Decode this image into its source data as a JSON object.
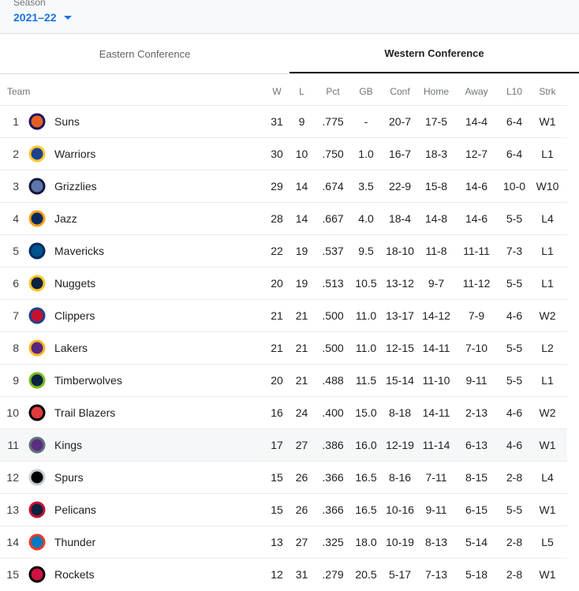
{
  "season": {
    "label": "Season",
    "value": "2021–22"
  },
  "tabs": [
    {
      "label": "Eastern Conference",
      "active": false
    },
    {
      "label": "Western Conference",
      "active": true
    }
  ],
  "columns": [
    "Team",
    "W",
    "L",
    "Pct",
    "GB",
    "Conf",
    "Home",
    "Away",
    "L10",
    "Strk"
  ],
  "teams": [
    {
      "rank": "1",
      "name": "Suns",
      "w": "31",
      "l": "9",
      "pct": ".775",
      "gb": "-",
      "conf": "20-7",
      "home": "17-5",
      "away": "14-4",
      "l10": "6-4",
      "strk": "W1",
      "logo": "suns-logo-icon",
      "color": "#e56020",
      "color2": "#1d1160"
    },
    {
      "rank": "2",
      "name": "Warriors",
      "w": "30",
      "l": "10",
      "pct": ".750",
      "gb": "1.0",
      "conf": "16-7",
      "home": "18-3",
      "away": "12-7",
      "l10": "6-4",
      "strk": "L1",
      "logo": "warriors-logo-icon",
      "color": "#1d428a",
      "color2": "#ffc72c"
    },
    {
      "rank": "3",
      "name": "Grizzlies",
      "w": "29",
      "l": "14",
      "pct": ".674",
      "gb": "3.5",
      "conf": "22-9",
      "home": "15-8",
      "away": "14-6",
      "l10": "10-0",
      "strk": "W10",
      "logo": "grizzlies-logo-icon",
      "color": "#5d76a9",
      "color2": "#12173f"
    },
    {
      "rank": "4",
      "name": "Jazz",
      "w": "28",
      "l": "14",
      "pct": ".667",
      "gb": "4.0",
      "conf": "18-4",
      "home": "14-8",
      "away": "14-6",
      "l10": "5-5",
      "strk": "L4",
      "logo": "jazz-logo-icon",
      "color": "#002b5c",
      "color2": "#f9a01b"
    },
    {
      "rank": "5",
      "name": "Mavericks",
      "w": "22",
      "l": "19",
      "pct": ".537",
      "gb": "9.5",
      "conf": "18-10",
      "home": "11-8",
      "away": "11-11",
      "l10": "7-3",
      "strk": "L1",
      "logo": "mavericks-logo-icon",
      "color": "#00538c",
      "color2": "#002b5e"
    },
    {
      "rank": "6",
      "name": "Nuggets",
      "w": "20",
      "l": "19",
      "pct": ".513",
      "gb": "10.5",
      "conf": "13-12",
      "home": "9-7",
      "away": "11-12",
      "l10": "5-5",
      "strk": "L1",
      "logo": "nuggets-logo-icon",
      "color": "#0e2240",
      "color2": "#fec524"
    },
    {
      "rank": "7",
      "name": "Clippers",
      "w": "21",
      "l": "21",
      "pct": ".500",
      "gb": "11.0",
      "conf": "13-17",
      "home": "14-12",
      "away": "7-9",
      "l10": "4-6",
      "strk": "W2",
      "logo": "clippers-logo-icon",
      "color": "#c8102e",
      "color2": "#1d428a"
    },
    {
      "rank": "8",
      "name": "Lakers",
      "w": "21",
      "l": "21",
      "pct": ".500",
      "gb": "11.0",
      "conf": "12-15",
      "home": "14-11",
      "away": "7-10",
      "l10": "5-5",
      "strk": "L2",
      "logo": "lakers-logo-icon",
      "color": "#552583",
      "color2": "#fdb927"
    },
    {
      "rank": "9",
      "name": "Timberwolves",
      "w": "20",
      "l": "21",
      "pct": ".488",
      "gb": "11.5",
      "conf": "15-14",
      "home": "11-10",
      "away": "9-11",
      "l10": "5-5",
      "strk": "L1",
      "logo": "timberwolves-logo-icon",
      "color": "#0c2340",
      "color2": "#78be20"
    },
    {
      "rank": "10",
      "name": "Trail Blazers",
      "w": "16",
      "l": "24",
      "pct": ".400",
      "gb": "15.0",
      "conf": "8-18",
      "home": "14-11",
      "away": "2-13",
      "l10": "4-6",
      "strk": "W2",
      "logo": "trail-blazers-logo-icon",
      "color": "#e03a3e",
      "color2": "#000000"
    },
    {
      "rank": "11",
      "name": "Kings",
      "w": "17",
      "l": "27",
      "pct": ".386",
      "gb": "16.0",
      "conf": "12-19",
      "home": "11-14",
      "away": "6-13",
      "l10": "4-6",
      "strk": "W1",
      "logo": "kings-logo-icon",
      "color": "#5a2d81",
      "color2": "#63727a",
      "highlight": true
    },
    {
      "rank": "12",
      "name": "Spurs",
      "w": "15",
      "l": "26",
      "pct": ".366",
      "gb": "16.5",
      "conf": "8-16",
      "home": "7-11",
      "away": "8-15",
      "l10": "2-8",
      "strk": "L4",
      "logo": "spurs-logo-icon",
      "color": "#000000",
      "color2": "#c4ced4"
    },
    {
      "rank": "13",
      "name": "Pelicans",
      "w": "15",
      "l": "26",
      "pct": ".366",
      "gb": "16.5",
      "conf": "10-16",
      "home": "9-11",
      "away": "6-15",
      "l10": "5-5",
      "strk": "W1",
      "logo": "pelicans-logo-icon",
      "color": "#0c2340",
      "color2": "#c8102e"
    },
    {
      "rank": "14",
      "name": "Thunder",
      "w": "13",
      "l": "27",
      "pct": ".325",
      "gb": "18.0",
      "conf": "10-19",
      "home": "8-13",
      "away": "5-14",
      "l10": "2-8",
      "strk": "L5",
      "logo": "thunder-logo-icon",
      "color": "#007ac1",
      "color2": "#ef3b24"
    },
    {
      "rank": "15",
      "name": "Rockets",
      "w": "12",
      "l": "31",
      "pct": ".279",
      "gb": "20.5",
      "conf": "5-17",
      "home": "7-13",
      "away": "5-18",
      "l10": "2-8",
      "strk": "W1",
      "logo": "rockets-logo-icon",
      "color": "#ce1141",
      "color2": "#000000"
    }
  ]
}
